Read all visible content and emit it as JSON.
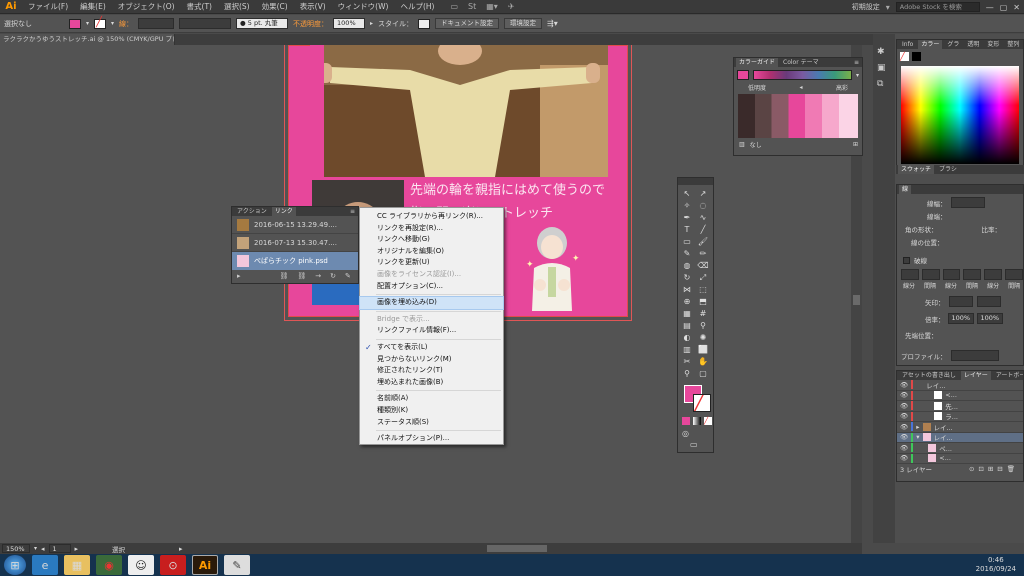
{
  "app": {
    "logo": "Ai",
    "workspace": "初期設定",
    "search_placeholder": "Adobe Stock を検索"
  },
  "menu": [
    "ファイル(F)",
    "編集(E)",
    "オブジェクト(O)",
    "書式(T)",
    "選択(S)",
    "効果(C)",
    "表示(V)",
    "ウィンドウ(W)",
    "ヘルプ(H)"
  ],
  "control": {
    "selection": "選択なし",
    "stroke_label": "線：",
    "brush": "5 pt. 丸筆",
    "opacity_label": "不透明度：",
    "opacity": "100%",
    "style_label": "スタイル：",
    "doc_setup": "ドキュメント設定",
    "prefs": "環境設定"
  },
  "doc_tab": "ラクラクかうゆうストレッチ.ai @ 150% (CMYK/GPU プレビュー)",
  "artwork": {
    "line1": "先端の輪を親指にはめて使うので",
    "line2": "指の間で楽にストレッチ"
  },
  "links_panel": {
    "tabs": [
      "アクション",
      "リンク"
    ],
    "items": [
      "2016-06-15 13.29.49....",
      "2016-07-13 15.30.47....",
      "ぺぱらチック pink.psd"
    ]
  },
  "context_menu": {
    "groups": [
      [
        {
          "label": "CC ライブラリから再リンク(R)...",
          "enabled": true
        },
        {
          "label": "リンクを再設定(R)...",
          "enabled": true
        },
        {
          "label": "リンクへ移動(G)",
          "enabled": true
        },
        {
          "label": "オリジナルを編集(O)",
          "enabled": true
        },
        {
          "label": "リンクを更新(U)",
          "enabled": true
        },
        {
          "label": "画像をライセンス認証(I)...",
          "enabled": false
        },
        {
          "label": "配置オプション(C)...",
          "enabled": true
        }
      ],
      [
        {
          "label": "画像を埋め込み(D)",
          "enabled": true,
          "highlight": true
        }
      ],
      [
        {
          "label": "Bridge で表示...",
          "enabled": false
        },
        {
          "label": "リンクファイル情報(F)...",
          "enabled": true
        }
      ],
      [
        {
          "label": "すべてを表示(L)",
          "enabled": true,
          "checked": true
        },
        {
          "label": "見つからないリンク(M)",
          "enabled": true
        },
        {
          "label": "修正されたリンク(T)",
          "enabled": true
        },
        {
          "label": "埋め込まれた画像(B)",
          "enabled": true
        }
      ],
      [
        {
          "label": "名前順(A)",
          "enabled": true
        },
        {
          "label": "種類別(K)",
          "enabled": true
        },
        {
          "label": "ステータス順(S)",
          "enabled": true
        }
      ],
      [
        {
          "label": "パネルオプション(P)...",
          "enabled": true
        }
      ]
    ]
  },
  "color_guide": {
    "tabs": [
      "カラーガイド",
      "Color テーマ"
    ],
    "low": "低明度",
    "high": "高彩",
    "none": "なし"
  },
  "color_panel": {
    "tabs": [
      "Info",
      "カラー",
      "グラ",
      "透明",
      "変形",
      "整列"
    ],
    "swatch_tabs": [
      "スウォッチ",
      "ブラシ"
    ]
  },
  "stroke_panel": {
    "title": "線",
    "weight_label": "線幅：",
    "cap_label": "線端：",
    "corner_label": "角の形状：",
    "limit_label": "比率：",
    "align_label": "線の位置：",
    "dash_label": "破線",
    "dash_labels": [
      "線分",
      "間隔",
      "線分",
      "間隔",
      "線分",
      "間隔"
    ],
    "arrow_start_label": "矢印：",
    "scale_label": "倍率：",
    "scale1": "100%",
    "scale2": "100%",
    "arrow_align_label": "先端位置：",
    "profile_label": "プロファイル："
  },
  "layers_panel": {
    "tabs": [
      "アセットの書き出し",
      "レイヤー",
      "アートボード"
    ],
    "rows": [
      "レイ...",
      "<...",
      "先...",
      "ラ...",
      "レイ...",
      "レイ...",
      "ペ...",
      "<..."
    ],
    "count": "3 レイヤー"
  },
  "status": {
    "zoom": "150%",
    "page": "1",
    "tool": "選択"
  },
  "taskbar": {
    "time": "0:46",
    "date": "2016/09/24"
  }
}
